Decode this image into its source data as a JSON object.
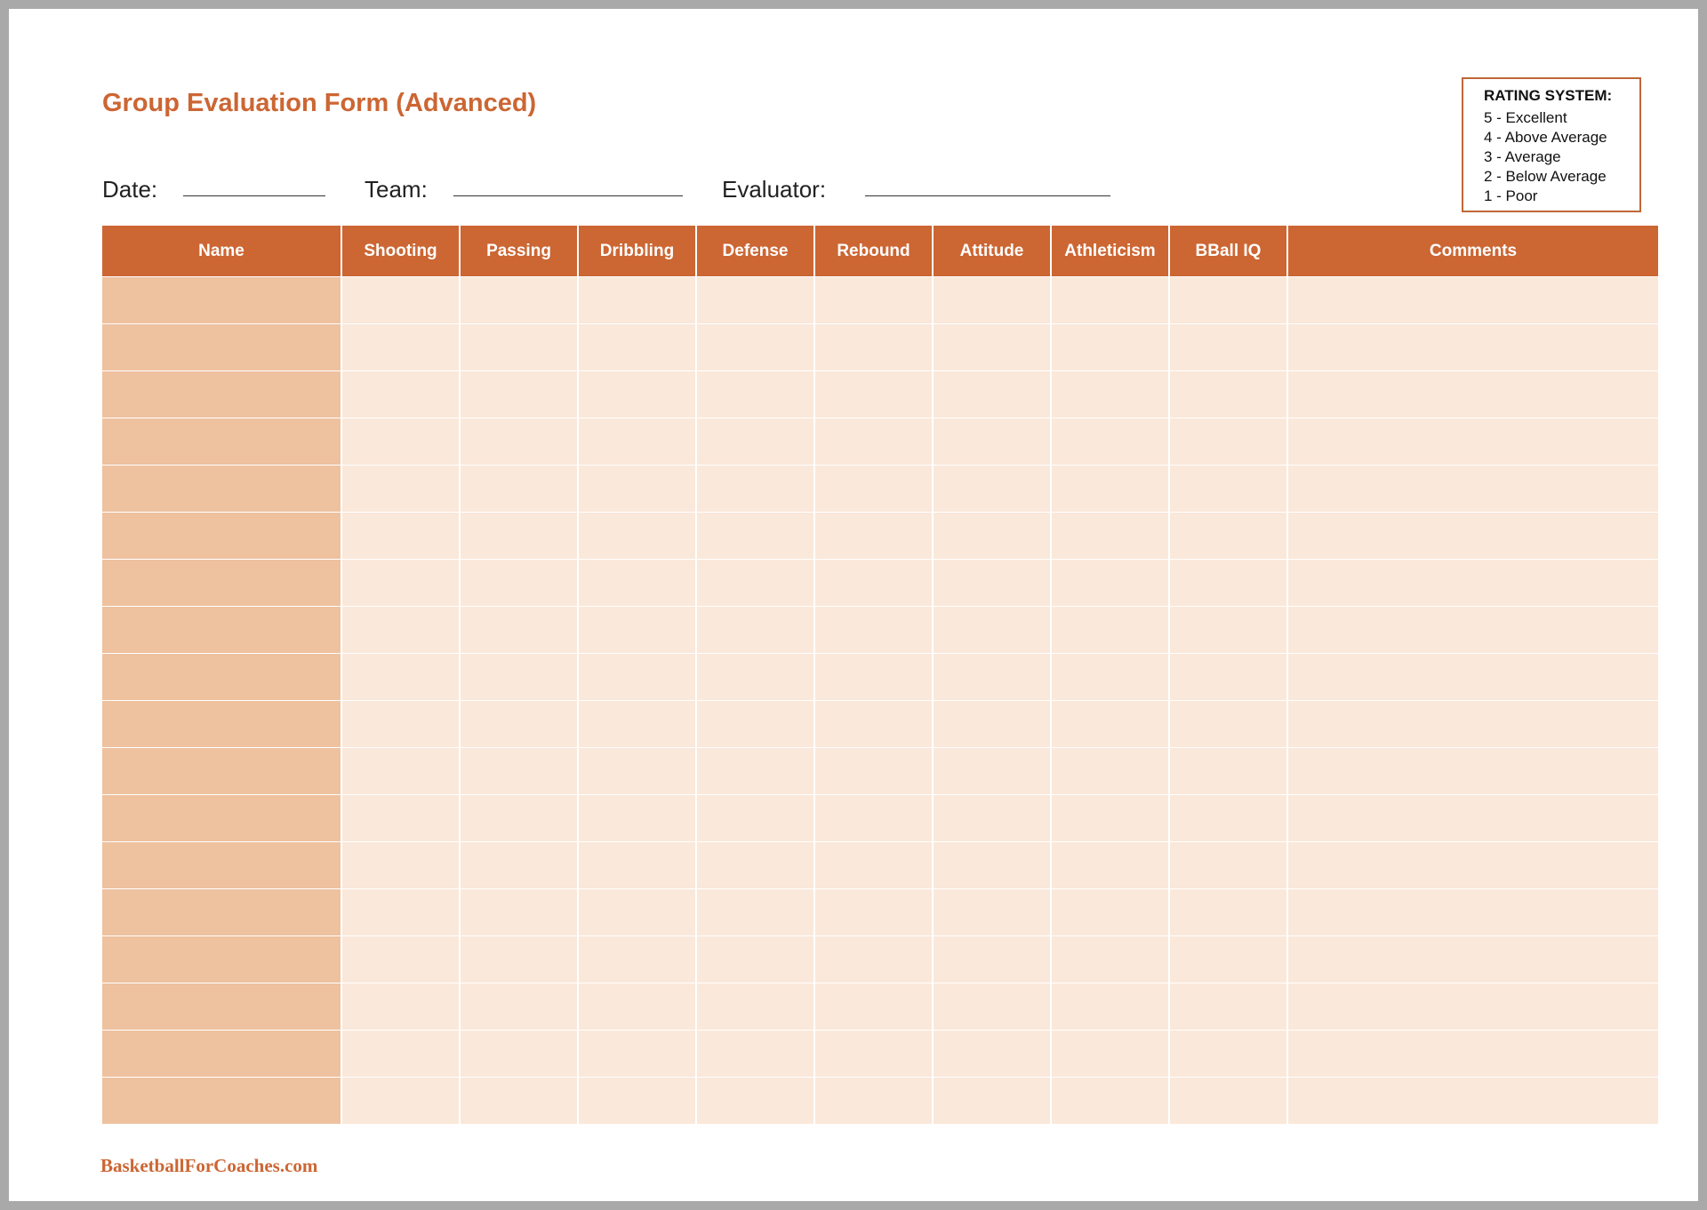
{
  "form": {
    "title": "Group Evaluation Form (Advanced)"
  },
  "fields": {
    "date_label": "Date:",
    "team_label": "Team:",
    "evaluator_label": "Evaluator:"
  },
  "rating_system": {
    "title": "RATING SYSTEM:",
    "items": [
      "5 - Excellent",
      "4 - Above Average",
      "3 - Average",
      "2 - Below Average",
      "1 - Poor"
    ]
  },
  "table": {
    "columns": [
      "Name",
      "Shooting",
      "Passing",
      "Dribbling",
      "Defense",
      "Rebound",
      "Attitude",
      "Athleticism",
      "BBall IQ",
      "Comments"
    ],
    "row_count": 18
  },
  "colors": {
    "accent": "#cc6633",
    "name_cell": "#eec19f",
    "body_cell": "#fae8da"
  },
  "footer": {
    "text": "BasketballForCoaches.com"
  }
}
